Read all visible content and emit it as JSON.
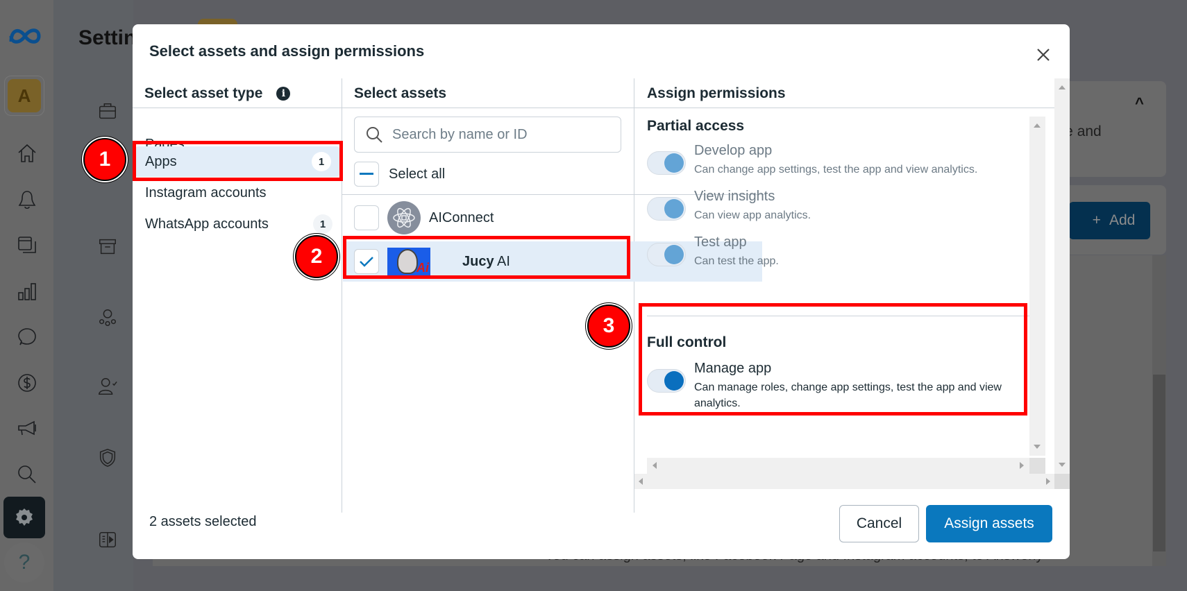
{
  "background": {
    "page_title": "Settings",
    "card_text": "nce and",
    "add_button_label": "Add",
    "bottom_text": "You can assign assets, like Facebook Page and Instagram accounts, to Answerly",
    "avatar_letter": "A",
    "help_label": "?"
  },
  "dialog": {
    "title": "Select assets and assign permissions",
    "columns": {
      "asset_type": {
        "heading": "Select asset type",
        "items": [
          {
            "label": "Pages",
            "badge": null,
            "selected": false
          },
          {
            "label": "Apps",
            "badge": "1",
            "selected": true
          },
          {
            "label": "Instagram accounts",
            "badge": null,
            "selected": false
          },
          {
            "label": "WhatsApp accounts",
            "badge": "1",
            "selected": false
          }
        ]
      },
      "assets": {
        "heading": "Select assets",
        "search_placeholder": "Search by name or ID",
        "search_value": "",
        "select_all_label": "Select all",
        "select_all_state": "indeterminate",
        "items": [
          {
            "name": "AIConnect",
            "checked": false
          },
          {
            "name_bold": "Jucy",
            "name_rest": "AI",
            "checked": true
          }
        ]
      },
      "permissions": {
        "heading": "Assign permissions",
        "sections": [
          {
            "title": "Partial access",
            "items": [
              {
                "name": "Develop app",
                "description": "Can change app settings, test the app and view analytics.",
                "enabled": true
              },
              {
                "name": "View insights",
                "description": "Can view app analytics.",
                "enabled": true
              },
              {
                "name": "Test app",
                "description": "Can test the app.",
                "enabled": true
              }
            ]
          },
          {
            "title": "Full control",
            "items": [
              {
                "name": "Manage app",
                "description": "Can manage roles, change app settings, test the app and view analytics.",
                "enabled": true
              }
            ]
          }
        ]
      }
    },
    "footer": {
      "status": "2 assets selected",
      "cancel_label": "Cancel",
      "primary_label": "Assign assets"
    }
  },
  "annotations": [
    {
      "number": "1",
      "target": "Apps"
    },
    {
      "number": "2",
      "target": "Jucy AI"
    },
    {
      "number": "3",
      "target": "Full control"
    }
  ],
  "colors": {
    "primary": "#0a78be",
    "selected_bg": "#e2edf8",
    "annotation_red": "#ff0000"
  }
}
